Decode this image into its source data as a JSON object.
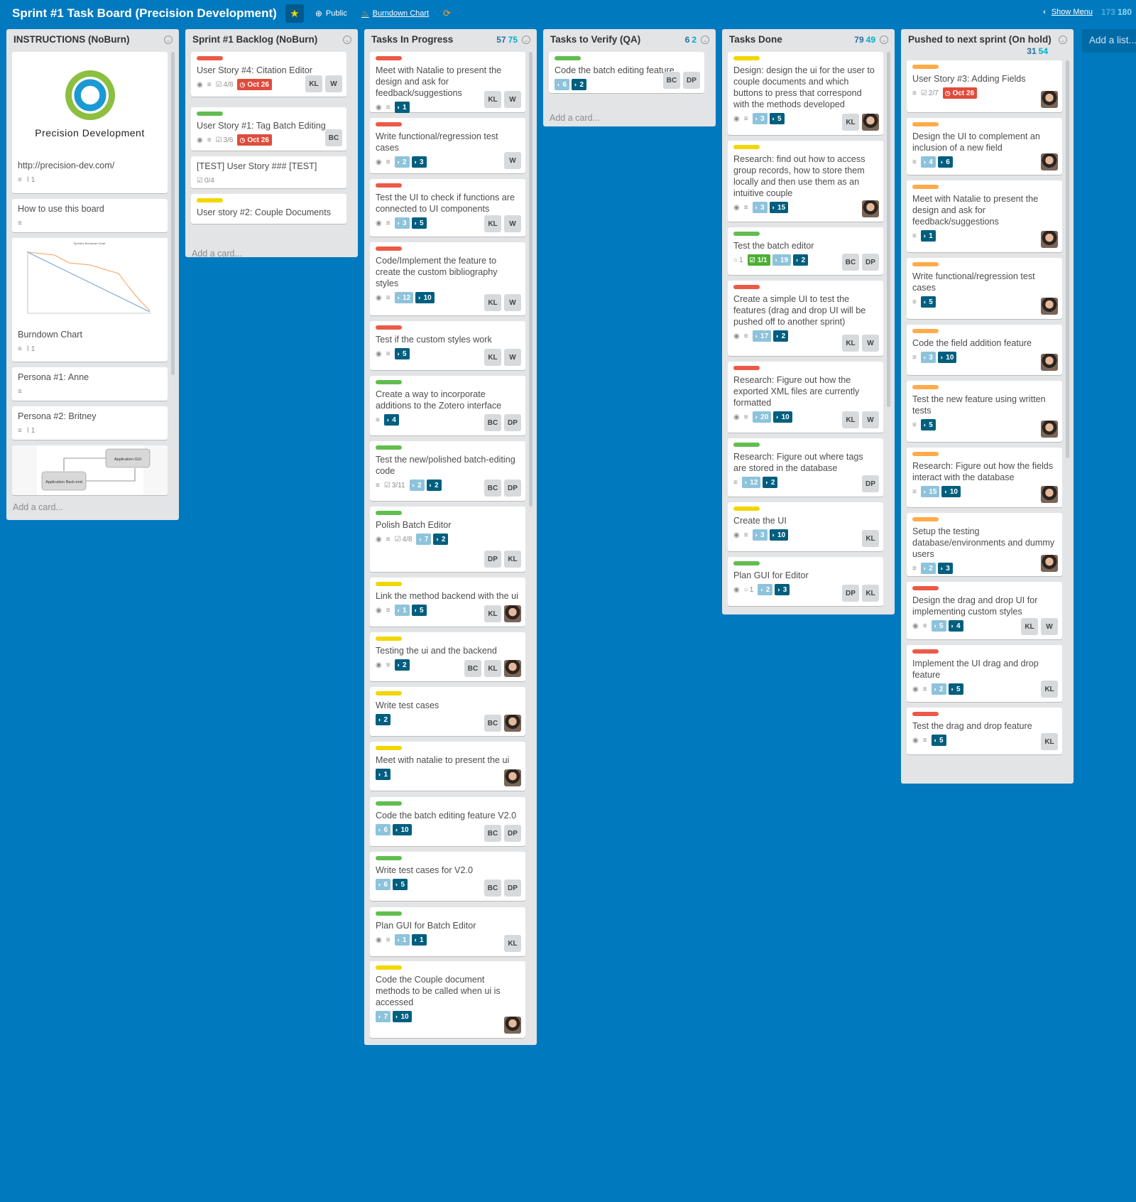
{
  "board": {
    "title": "Sprint #1 Task Board (Precision Development)",
    "visibility": "Public",
    "burndown_link": "Burndown Chart",
    "show_menu": "Show Menu",
    "points_a": "173",
    "points_b": "180"
  },
  "add_list": "Add a list...",
  "add_card": "Add a card...",
  "colors": {
    "board_bg": "#0079bf",
    "label_red": "#eb5a46",
    "label_green": "#61bd4f",
    "label_yellow": "#f2d600",
    "label_orange": "#ffab4a"
  },
  "instructions": {
    "name": "INSTRUCTIONS (NoBurn)",
    "logo_text": "Precision Development",
    "url": "http://precision-dev.com/",
    "url_attachments": "1",
    "how_to": "How to use this board",
    "burndown_title": "Burndown Chart",
    "burndown_attachments": "1",
    "burndown_thumb_title": "Sprint#1 Burndown Chart",
    "persona1": "Persona #1: Anne",
    "persona2": "Persona #2: Britney",
    "persona2_attachments": "1",
    "diagram_gui": "Application GUI",
    "diagram_backend": "Application Back-end"
  },
  "lists": [
    {
      "name": "Sprint #1 Backlog (NoBurn)",
      "cards": [
        {
          "label": "red",
          "title": "User Story #4: Citation Editor",
          "checklist": "4/8",
          "due": "Oct 26",
          "members": [
            "KL",
            "W"
          ]
        },
        {
          "label": "green",
          "title": "User Story #1: Tag Batch Editing",
          "checklist": "3/6",
          "due": "Oct 26",
          "members": [
            "BC"
          ]
        },
        {
          "label": "",
          "title": "[TEST] User Story ### [TEST]",
          "checklist": "0/4",
          "members": []
        },
        {
          "label": "yellow",
          "title": "User story #2: Couple Documents",
          "members": []
        }
      ]
    },
    {
      "name": "Tasks In Progress",
      "pts_a": "57",
      "pts_b": "75",
      "cards": [
        {
          "label": "red",
          "title": "Meet with Natalie to present the design and ask for feedback/suggestions",
          "dark": "1",
          "members": [
            "KL",
            "W"
          ]
        },
        {
          "label": "red",
          "title": "Write functional/regression test cases",
          "light": "2",
          "dark": "3",
          "members": [
            "W"
          ]
        },
        {
          "label": "red",
          "title": "Test the UI to check if functions are connected to UI components",
          "light": "3",
          "dark": "5",
          "members": [
            "KL",
            "W"
          ]
        },
        {
          "label": "red",
          "title": "Code/Implement the feature to create the custom bibliography styles",
          "light": "12",
          "dark": "10",
          "members": [
            "KL",
            "W"
          ]
        },
        {
          "label": "red",
          "title": "Test if the custom styles work",
          "dark": "5",
          "members": [
            "KL",
            "W"
          ]
        },
        {
          "label": "green",
          "title": "Create a way to incorporate additions to the Zotero interface",
          "dark": "4",
          "members": [
            "BC",
            "DP"
          ]
        },
        {
          "label": "green",
          "title": "Test the new/polished batch-editing code",
          "checklist": "3/11",
          "light": "2",
          "dark": "2",
          "members": [
            "BC",
            "DP"
          ]
        },
        {
          "label": "green",
          "title": "Polish Batch Editor",
          "checklist": "4/8",
          "light": "7",
          "dark": "2",
          "members": [
            "DP",
            "KL"
          ]
        },
        {
          "label": "yellow",
          "title": "Link the method backend with the ui",
          "light": "1",
          "dark": "5",
          "members": [
            "KL",
            "photo"
          ]
        },
        {
          "label": "yellow",
          "title": "Testing the ui and the backend",
          "dark": "2",
          "members": [
            "BC",
            "KL",
            "photo"
          ]
        },
        {
          "label": "yellow",
          "title": "Write test cases",
          "dark": "2",
          "members": [
            "BC",
            "photo"
          ]
        },
        {
          "label": "yellow",
          "title": "Meet with natalie to present the ui",
          "dark": "1",
          "members": [
            "photo"
          ]
        },
        {
          "label": "green",
          "title": "Code the batch editing feature V2.0",
          "light": "6",
          "dark": "10",
          "members": [
            "BC",
            "DP"
          ]
        },
        {
          "label": "green",
          "title": "Write test cases for V2.0",
          "light": "6",
          "dark": "5",
          "members": [
            "BC",
            "DP"
          ]
        },
        {
          "label": "green",
          "title": "Plan GUI for Batch Editor",
          "light": "1",
          "dark": "1",
          "members": [
            "KL"
          ]
        },
        {
          "label": "yellow",
          "title": "Code the Couple document methods to be called when ui is accessed",
          "light": "7",
          "dark": "10",
          "members": [
            "photo"
          ]
        }
      ]
    },
    {
      "name": "Tasks to Verify (QA)",
      "pts_a": "6",
      "pts_b": "2",
      "cards": [
        {
          "label": "green",
          "title": "Code the batch editing feature",
          "light": "6",
          "dark": "2",
          "members": [
            "BC",
            "DP"
          ]
        }
      ]
    },
    {
      "name": "Tasks Done",
      "pts_a": "79",
      "pts_b": "49",
      "cards": [
        {
          "label": "yellow",
          "title": "Design: design the ui for the user to couple documents and which buttons to press that correspond with the methods developed",
          "light": "3",
          "dark": "5",
          "members": [
            "KL",
            "photo"
          ]
        },
        {
          "label": "yellow",
          "title": "Research: find out how to access group records, how to store them locally and then use them as an intuitive couple",
          "light": "3",
          "dark": "15",
          "members": [
            "photo"
          ]
        },
        {
          "label": "green",
          "title": "Test the batch editor",
          "comments": "1",
          "done": "1/1",
          "light": "19",
          "dark": "2",
          "members": [
            "BC",
            "DP"
          ]
        },
        {
          "label": "red",
          "title": "Create a simple UI to test the features (drag and drop UI will be pushed off to another sprint)",
          "light": "17",
          "dark": "2",
          "members": [
            "KL",
            "W"
          ]
        },
        {
          "label": "red",
          "title": "Research: Figure out how the exported XML files are currently formatted",
          "light": "20",
          "dark": "10",
          "members": [
            "KL",
            "W"
          ]
        },
        {
          "label": "green",
          "title": "Research: Figure out where tags are stored in the database",
          "light": "12",
          "dark": "2",
          "members": [
            "DP"
          ]
        },
        {
          "label": "yellow",
          "title": "Create the UI",
          "light": "3",
          "dark": "10",
          "members": [
            "KL"
          ]
        },
        {
          "label": "green",
          "title": "Plan GUI for Editor",
          "comments": "1",
          "light": "2",
          "dark": "3",
          "members": [
            "DP",
            "KL"
          ]
        }
      ]
    },
    {
      "name": "Pushed to next sprint (On hold)",
      "pts_a": "31",
      "pts_b": "54",
      "cards": [
        {
          "label": "orange",
          "title": "User Story #3: Adding Fields",
          "checklist": "2/7",
          "due": "Oct 26",
          "members": [
            "photo"
          ]
        },
        {
          "label": "orange",
          "title": "Design the UI to complement an inclusion of a new field",
          "light": "4",
          "dark": "6",
          "members": [
            "photo"
          ]
        },
        {
          "label": "orange",
          "title": "Meet with Natalie to present the design and ask for feedback/suggestions",
          "dark": "1",
          "members": [
            "photo"
          ]
        },
        {
          "label": "orange",
          "title": "Write functional/regression test cases",
          "dark": "5",
          "members": [
            "photo"
          ]
        },
        {
          "label": "orange",
          "title": "Code the field addition feature",
          "light": "3",
          "dark": "10",
          "members": [
            "photo"
          ]
        },
        {
          "label": "orange",
          "title": "Test the new feature using written tests",
          "dark": "5",
          "members": [
            "photo"
          ]
        },
        {
          "label": "orange",
          "title": "Research: Figure out how the fields interact with the database",
          "light": "15",
          "dark": "10",
          "members": [
            "photo"
          ]
        },
        {
          "label": "orange",
          "title": "Setup the testing database/environments and dummy users",
          "light": "2",
          "dark": "3",
          "members": [
            "photo"
          ]
        },
        {
          "label": "red",
          "title": "Design the drag and drop UI for implementing custom styles",
          "light": "5",
          "dark": "4",
          "members": [
            "KL",
            "W"
          ]
        },
        {
          "label": "red",
          "title": "Implement the UI drag and drop feature",
          "light": "2",
          "dark": "5",
          "members": [
            "KL"
          ]
        },
        {
          "label": "red",
          "title": "Test the drag and drop feature",
          "dark": "5",
          "members": [
            "KL"
          ]
        }
      ]
    }
  ]
}
